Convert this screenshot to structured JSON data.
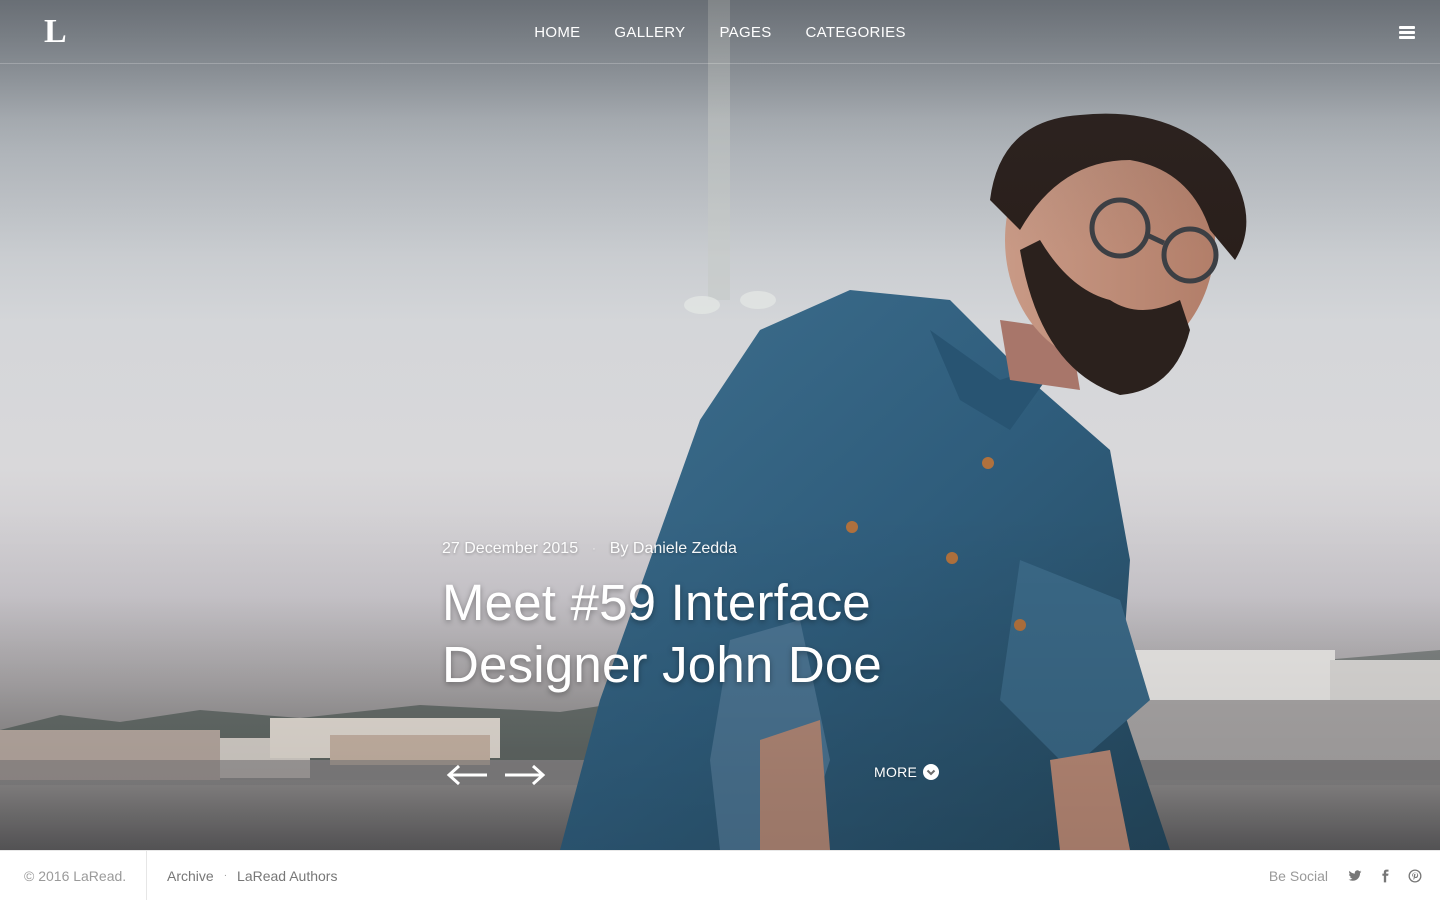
{
  "brand": {
    "logo": "L"
  },
  "nav": {
    "items": [
      {
        "label": "HOME"
      },
      {
        "label": "GALLERY"
      },
      {
        "label": "PAGES"
      },
      {
        "label": "CATEGORIES"
      }
    ],
    "menu_icon": "hamburger-menu-icon"
  },
  "post": {
    "date": "27 December 2015",
    "separator": "·",
    "author": "By Daniele Zedda",
    "title_line1": "Meet #59 Interface",
    "title_line2": "Designer John Doe"
  },
  "slider": {
    "prev_icon": "arrow-left-icon",
    "next_icon": "arrow-right-icon",
    "more_label": "MORE",
    "more_icon": "chevron-down-circle-icon"
  },
  "footer": {
    "copyright": "© 2016 LaRead.",
    "links": [
      {
        "label": "Archive"
      },
      {
        "label": "LaRead Authors"
      }
    ],
    "link_separator": "·",
    "social_label": "Be Social",
    "social_icons": [
      "twitter-icon",
      "facebook-icon",
      "pinterest-icon"
    ]
  },
  "colors": {
    "nav_text": "#ffffff",
    "footer_text": "#8c8c8c",
    "footer_bg": "#ffffff"
  }
}
